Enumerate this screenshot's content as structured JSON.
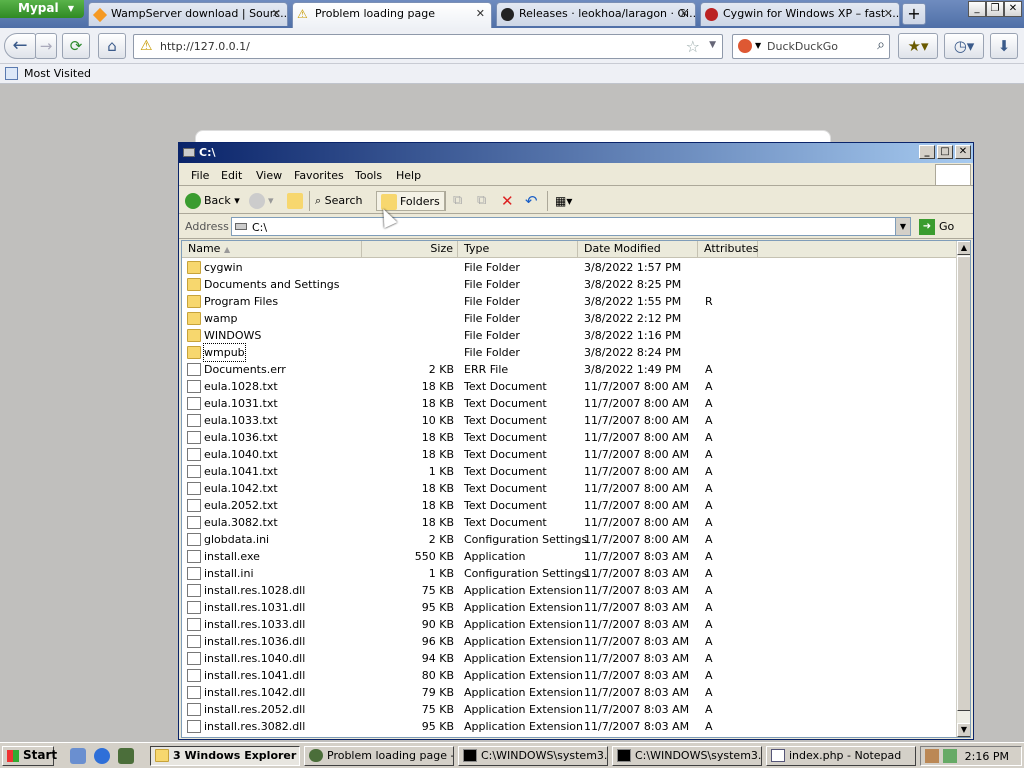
{
  "browser": {
    "brand": "Mypal",
    "tabs": [
      {
        "label": "WampServer download | Sourc..."
      },
      {
        "label": "Problem loading page"
      },
      {
        "label": "Releases · leokhoa/laragon · Gi..."
      },
      {
        "label": "Cygwin for Windows XP – fast ..."
      }
    ],
    "url": "http://127.0.0.1/",
    "search_placeholder": "DuckDuckGo",
    "bookmark": "Most Visited"
  },
  "explorer": {
    "title": "C:\\",
    "menus": [
      "File",
      "Edit",
      "View",
      "Favorites",
      "Tools",
      "Help"
    ],
    "toolbar": {
      "back": "Back",
      "search": "Search",
      "folders": "Folders"
    },
    "address_label": "Address",
    "address": "C:\\",
    "go": "Go",
    "columns": {
      "name": "Name",
      "size": "Size",
      "type": "Type",
      "date": "Date Modified",
      "attributes": "Attributes"
    },
    "files": [
      {
        "name": "cygwin",
        "size": "",
        "type": "File Folder",
        "date": "3/8/2022 1:57 PM",
        "attr": "",
        "icon": "folder"
      },
      {
        "name": "Documents and Settings",
        "size": "",
        "type": "File Folder",
        "date": "3/8/2022 8:25 PM",
        "attr": "",
        "icon": "folder"
      },
      {
        "name": "Program Files",
        "size": "",
        "type": "File Folder",
        "date": "3/8/2022 1:55 PM",
        "attr": "R",
        "icon": "folder"
      },
      {
        "name": "wamp",
        "size": "",
        "type": "File Folder",
        "date": "3/8/2022 2:12 PM",
        "attr": "",
        "icon": "folder"
      },
      {
        "name": "WINDOWS",
        "size": "",
        "type": "File Folder",
        "date": "3/8/2022 1:16 PM",
        "attr": "",
        "icon": "folder"
      },
      {
        "name": "wmpub",
        "size": "",
        "type": "File Folder",
        "date": "3/8/2022 8:24 PM",
        "attr": "",
        "icon": "folder"
      },
      {
        "name": "Documents.err",
        "size": "2 KB",
        "type": "ERR File",
        "date": "3/8/2022 1:49 PM",
        "attr": "A",
        "icon": "file"
      },
      {
        "name": "eula.1028.txt",
        "size": "18 KB",
        "type": "Text Document",
        "date": "11/7/2007 8:00 AM",
        "attr": "A",
        "icon": "file"
      },
      {
        "name": "eula.1031.txt",
        "size": "18 KB",
        "type": "Text Document",
        "date": "11/7/2007 8:00 AM",
        "attr": "A",
        "icon": "file"
      },
      {
        "name": "eula.1033.txt",
        "size": "10 KB",
        "type": "Text Document",
        "date": "11/7/2007 8:00 AM",
        "attr": "A",
        "icon": "file"
      },
      {
        "name": "eula.1036.txt",
        "size": "18 KB",
        "type": "Text Document",
        "date": "11/7/2007 8:00 AM",
        "attr": "A",
        "icon": "file"
      },
      {
        "name": "eula.1040.txt",
        "size": "18 KB",
        "type": "Text Document",
        "date": "11/7/2007 8:00 AM",
        "attr": "A",
        "icon": "file"
      },
      {
        "name": "eula.1041.txt",
        "size": "1 KB",
        "type": "Text Document",
        "date": "11/7/2007 8:00 AM",
        "attr": "A",
        "icon": "file"
      },
      {
        "name": "eula.1042.txt",
        "size": "18 KB",
        "type": "Text Document",
        "date": "11/7/2007 8:00 AM",
        "attr": "A",
        "icon": "file"
      },
      {
        "name": "eula.2052.txt",
        "size": "18 KB",
        "type": "Text Document",
        "date": "11/7/2007 8:00 AM",
        "attr": "A",
        "icon": "file"
      },
      {
        "name": "eula.3082.txt",
        "size": "18 KB",
        "type": "Text Document",
        "date": "11/7/2007 8:00 AM",
        "attr": "A",
        "icon": "file"
      },
      {
        "name": "globdata.ini",
        "size": "2 KB",
        "type": "Configuration Settings",
        "date": "11/7/2007 8:00 AM",
        "attr": "A",
        "icon": "file"
      },
      {
        "name": "install.exe",
        "size": "550 KB",
        "type": "Application",
        "date": "11/7/2007 8:03 AM",
        "attr": "A",
        "icon": "file"
      },
      {
        "name": "install.ini",
        "size": "1 KB",
        "type": "Configuration Settings",
        "date": "11/7/2007 8:03 AM",
        "attr": "A",
        "icon": "file"
      },
      {
        "name": "install.res.1028.dll",
        "size": "75 KB",
        "type": "Application Extension",
        "date": "11/7/2007 8:03 AM",
        "attr": "A",
        "icon": "file"
      },
      {
        "name": "install.res.1031.dll",
        "size": "95 KB",
        "type": "Application Extension",
        "date": "11/7/2007 8:03 AM",
        "attr": "A",
        "icon": "file"
      },
      {
        "name": "install.res.1033.dll",
        "size": "90 KB",
        "type": "Application Extension",
        "date": "11/7/2007 8:03 AM",
        "attr": "A",
        "icon": "file"
      },
      {
        "name": "install.res.1036.dll",
        "size": "96 KB",
        "type": "Application Extension",
        "date": "11/7/2007 8:03 AM",
        "attr": "A",
        "icon": "file"
      },
      {
        "name": "install.res.1040.dll",
        "size": "94 KB",
        "type": "Application Extension",
        "date": "11/7/2007 8:03 AM",
        "attr": "A",
        "icon": "file"
      },
      {
        "name": "install.res.1041.dll",
        "size": "80 KB",
        "type": "Application Extension",
        "date": "11/7/2007 8:03 AM",
        "attr": "A",
        "icon": "file"
      },
      {
        "name": "install.res.1042.dll",
        "size": "79 KB",
        "type": "Application Extension",
        "date": "11/7/2007 8:03 AM",
        "attr": "A",
        "icon": "file"
      },
      {
        "name": "install.res.2052.dll",
        "size": "75 KB",
        "type": "Application Extension",
        "date": "11/7/2007 8:03 AM",
        "attr": "A",
        "icon": "file"
      },
      {
        "name": "install.res.3082.dll",
        "size": "95 KB",
        "type": "Application Extension",
        "date": "11/7/2007 8:03 AM",
        "attr": "A",
        "icon": "file"
      }
    ]
  },
  "taskbar": {
    "start": "Start",
    "tasks": [
      {
        "label": "3 Windows Explorer",
        "icon": "folder-icon"
      },
      {
        "label": "Problem loading page -...",
        "icon": "browser-icon"
      },
      {
        "label": "C:\\WINDOWS\\system3...",
        "icon": "cmd-icon"
      },
      {
        "label": "C:\\WINDOWS\\system3...",
        "icon": "cmd-icon"
      },
      {
        "label": "index.php - Notepad",
        "icon": "notepad-icon"
      }
    ],
    "clock": "2:16 PM"
  }
}
